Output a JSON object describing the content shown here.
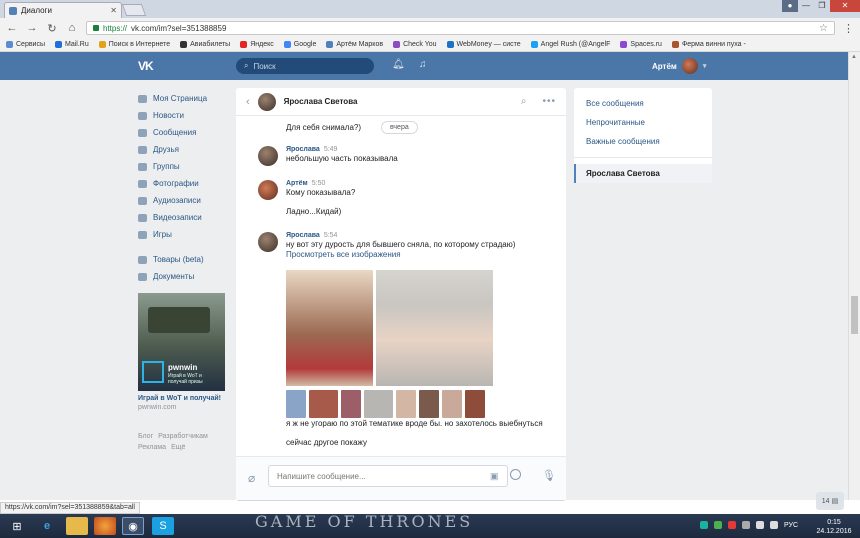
{
  "browser": {
    "tab_title": "Диалоги",
    "url_secure": "https://",
    "url_rest": "vk.com/im?sel=351388859",
    "bookmarks": [
      "Сервисы",
      "Mail.Ru",
      "Поиск в Интернете",
      "Авиабилеты",
      "Яндекс",
      "Google",
      "Артём Марков",
      "Check You",
      "WebMoney — систе",
      "Angel Rush (@AngelF",
      "Spaces.ru",
      "Ферма винни пуха -"
    ],
    "status_url": "https://vk.com/im?sel=351388859&tab=all"
  },
  "vk_header": {
    "logo": "VK",
    "search_placeholder": "Поиск",
    "user_name": "Артём"
  },
  "left_nav": {
    "items": [
      "Моя Страница",
      "Новости",
      "Сообщения",
      "Друзья",
      "Группы",
      "Фотографии",
      "Аудиозаписи",
      "Видеозаписи",
      "Игры"
    ],
    "items2": [
      "Товары (beta)",
      "Документы"
    ],
    "ad_brand": "pwnwin",
    "ad_sub": "Играй в WoT и получай призы",
    "ad_title": "Играй в WoT и получай!",
    "ad_site": "pwnwin.com",
    "footer": [
      "Блог",
      "Разработчикам",
      "Реклама",
      "Ещё"
    ]
  },
  "chat": {
    "peer_name": "Ярослава Светова",
    "first_line": "Для себя снимала?)",
    "date_pill": "вчера",
    "messages": [
      {
        "author": "Ярослава",
        "time": "5:49",
        "lines": [
          "небольшую часть показывала"
        ]
      },
      {
        "author": "Артём",
        "time": "5:50",
        "lines": [
          "Кому показывала?",
          "Ладно...Кидай)"
        ]
      },
      {
        "author": "Ярослава",
        "time": "5:54",
        "lines": [
          "ну вот эту дурость для бывшего сняла, по которому страдаю)"
        ],
        "link": "Просмотреть все изображения"
      }
    ],
    "after_photos": [
      "я ж не угораю по этой тематике вроде бы. но захотелось выебнуться",
      "сейчас другое покажу"
    ],
    "composer_placeholder": "Напишите сообщение..."
  },
  "right_menu": {
    "items": [
      "Все сообщения",
      "Непрочитанные",
      "Важные сообщения"
    ],
    "selected": "Ярослава Светова"
  },
  "counter": "14",
  "taskbar": {
    "banner": "GAME OF THRONES",
    "lang": "РУС",
    "time": "0:15",
    "date": "24.12.2016"
  }
}
